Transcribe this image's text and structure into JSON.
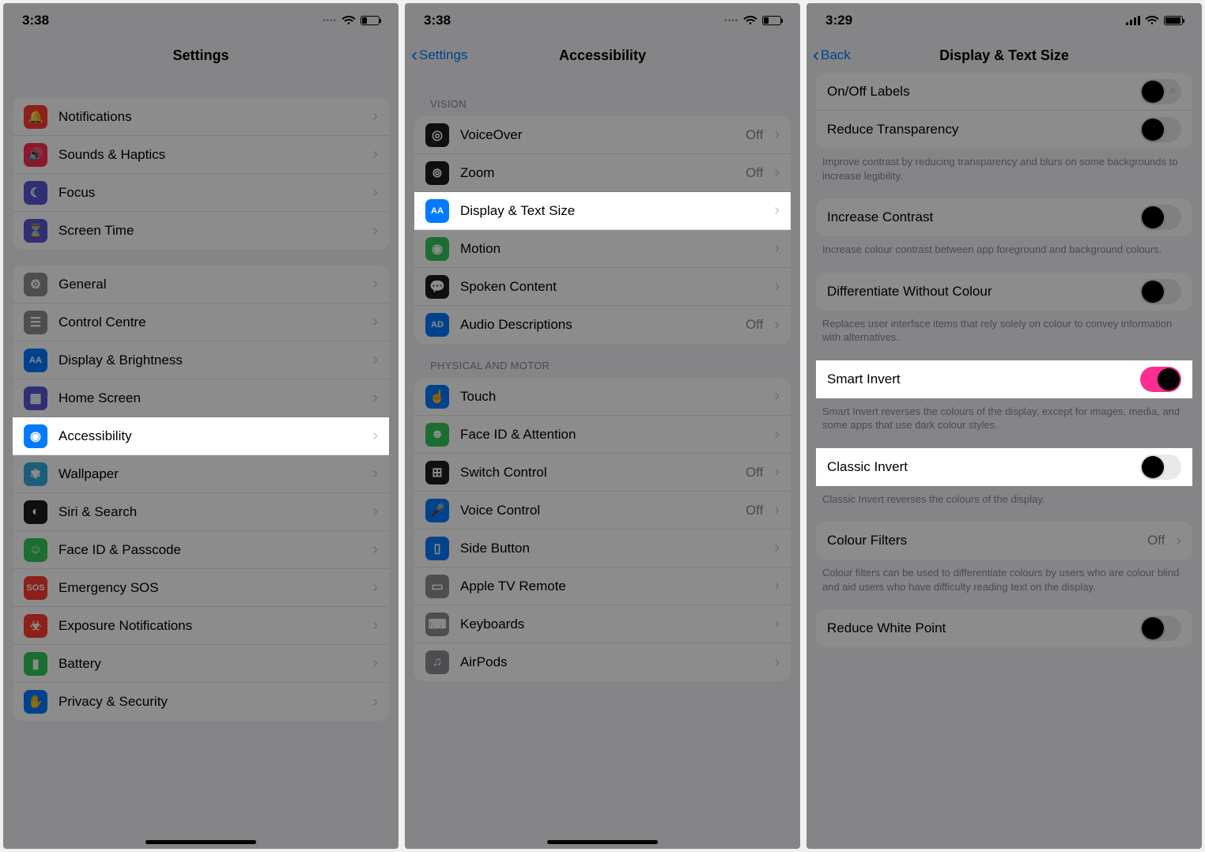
{
  "status": {
    "time1": "3:38",
    "time2": "3:38",
    "time3": "3:29",
    "wifi": "wifi",
    "battery_pct_12": 25,
    "battery_pct_3": 85
  },
  "panel1": {
    "title": "Settings",
    "groups": [
      {
        "rows": [
          {
            "icon": "bell-icon",
            "color": "ic-red",
            "label": "Notifications"
          },
          {
            "icon": "speaker-icon",
            "color": "ic-pink",
            "label": "Sounds & Haptics"
          },
          {
            "icon": "moon-icon",
            "color": "ic-indigo",
            "label": "Focus"
          },
          {
            "icon": "hourglass-icon",
            "color": "ic-indigo",
            "label": "Screen Time"
          }
        ]
      },
      {
        "rows": [
          {
            "icon": "gear-icon",
            "color": "ic-grey",
            "label": "General"
          },
          {
            "icon": "switches-icon",
            "color": "ic-grey",
            "label": "Control Centre"
          },
          {
            "icon": "aa-icon",
            "color": "ic-blue",
            "label": "Display & Brightness"
          },
          {
            "icon": "grid-icon",
            "color": "ic-indigo",
            "label": "Home Screen"
          },
          {
            "icon": "accessibility-icon",
            "color": "ic-blue",
            "label": "Accessibility",
            "highlight": true
          },
          {
            "icon": "flower-icon",
            "color": "ic-teal",
            "label": "Wallpaper"
          },
          {
            "icon": "siri-icon",
            "color": "ic-black",
            "label": "Siri & Search"
          },
          {
            "icon": "faceid-icon",
            "color": "ic-green",
            "label": "Face ID & Passcode"
          },
          {
            "icon": "sos-icon",
            "color": "ic-red",
            "label": "Emergency SOS"
          },
          {
            "icon": "virus-icon",
            "color": "ic-red",
            "label": "Exposure Notifications"
          },
          {
            "icon": "battery-icon",
            "color": "ic-green",
            "label": "Battery"
          },
          {
            "icon": "hand-icon",
            "color": "ic-blue",
            "label": "Privacy & Security"
          }
        ]
      }
    ]
  },
  "panel2": {
    "back": "Settings",
    "title": "Accessibility",
    "sections": [
      {
        "header": "VISION",
        "rows": [
          {
            "icon": "voiceover-icon",
            "color": "ic-black",
            "label": "VoiceOver",
            "value": "Off"
          },
          {
            "icon": "zoom-icon",
            "color": "ic-black",
            "label": "Zoom",
            "value": "Off"
          },
          {
            "icon": "aa-icon",
            "color": "ic-blue",
            "label": "Display & Text Size",
            "highlight": true
          },
          {
            "icon": "motion-icon",
            "color": "ic-green",
            "label": "Motion"
          },
          {
            "icon": "spoken-icon",
            "color": "ic-black",
            "label": "Spoken Content"
          },
          {
            "icon": "ad-icon",
            "color": "ic-blue",
            "label": "Audio Descriptions",
            "value": "Off"
          }
        ]
      },
      {
        "header": "PHYSICAL AND MOTOR",
        "rows": [
          {
            "icon": "touch-icon",
            "color": "ic-blue",
            "label": "Touch"
          },
          {
            "icon": "face-icon",
            "color": "ic-green",
            "label": "Face ID & Attention"
          },
          {
            "icon": "switch-icon",
            "color": "ic-black",
            "label": "Switch Control",
            "value": "Off"
          },
          {
            "icon": "voice-icon",
            "color": "ic-blue",
            "label": "Voice Control",
            "value": "Off"
          },
          {
            "icon": "sidebutton-icon",
            "color": "ic-blue",
            "label": "Side Button"
          },
          {
            "icon": "tvremote-icon",
            "color": "ic-grey",
            "label": "Apple TV Remote"
          },
          {
            "icon": "keyboard-icon",
            "color": "ic-grey",
            "label": "Keyboards"
          },
          {
            "icon": "airpods-icon",
            "color": "ic-grey",
            "label": "AirPods"
          }
        ]
      }
    ]
  },
  "panel3": {
    "back": "Back",
    "title": "Display & Text Size",
    "items": [
      {
        "type": "row-toggle",
        "label": "On/Off Labels",
        "on": false,
        "dark": true,
        "onoff": true
      },
      {
        "type": "row-toggle",
        "label": "Reduce Transparency",
        "on": false,
        "dark": true
      },
      {
        "type": "footer",
        "text": "Improve contrast by reducing transparency and blurs on some backgrounds to increase legibility."
      },
      {
        "type": "row-toggle",
        "label": "Increase Contrast",
        "on": false,
        "dark": true
      },
      {
        "type": "footer",
        "text": "Increase colour contrast between app foreground and background colours."
      },
      {
        "type": "row-toggle",
        "label": "Differentiate Without Colour",
        "on": false,
        "dark": true
      },
      {
        "type": "footer",
        "text": "Replaces user interface items that rely solely on colour to convey information with alternatives."
      },
      {
        "type": "row-toggle",
        "label": "Smart Invert",
        "on": true,
        "pink": true,
        "dark": true,
        "highlight": true
      },
      {
        "type": "footer",
        "text": "Smart Invert reverses the colours of the display, except for images, media, and some apps that use dark colour styles."
      },
      {
        "type": "row-toggle",
        "label": "Classic Invert",
        "on": false,
        "dark": true,
        "highlight": true
      },
      {
        "type": "footer",
        "text": "Classic Invert reverses the colours of the display."
      },
      {
        "type": "row-nav",
        "label": "Colour Filters",
        "value": "Off"
      },
      {
        "type": "footer",
        "text": "Colour filters can be used to differentiate colours by users who are colour blind and aid users who have difficulty reading text on the display."
      },
      {
        "type": "row-toggle",
        "label": "Reduce White Point",
        "on": false,
        "dark": true
      }
    ]
  }
}
